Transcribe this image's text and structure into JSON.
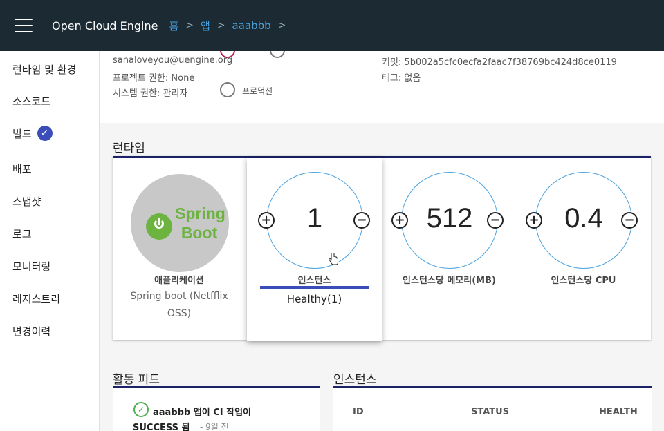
{
  "header": {
    "app_title": "Open Cloud Engine",
    "breadcrumb": [
      "홈",
      "앱",
      "aaabbb"
    ],
    "separator": ">"
  },
  "sidebar": {
    "items": [
      {
        "label": "런타임 및 환경"
      },
      {
        "label": "소스코드"
      },
      {
        "label": "빌드",
        "checked": true
      },
      {
        "label": "배포"
      },
      {
        "label": "스냅샷"
      },
      {
        "label": "로그"
      },
      {
        "label": "모니터링"
      },
      {
        "label": "레지스트리"
      },
      {
        "label": "변경이력"
      }
    ]
  },
  "info": {
    "email": "sanaloveyou@uengine.org",
    "project_permission": "프로젝트 권한: None",
    "system_permission": "시스템 권한: 관리자",
    "radio_production_label": "프로덕션",
    "commit": "커밋: 5b002a5cfc0ecfa2faac7f38769bc424d8ce0119",
    "tags": "태그: 없음"
  },
  "runtime": {
    "title": "런타임",
    "application": {
      "label": "애플리케이션",
      "logo_text_1": "Spring",
      "logo_text_2": "Boot",
      "sub_1": "Spring boot (Netfflix",
      "sub_2": "OSS)"
    },
    "instances": {
      "value": "1",
      "label": "인스턴스",
      "status": "Healthy(1)"
    },
    "memory": {
      "value": "512",
      "label": "인스턴스당 메모리(MB)"
    },
    "cpu": {
      "value": "0.4",
      "label": "인스턴스당 CPU"
    },
    "plus": "+",
    "minus": "−"
  },
  "activity": {
    "title": "활동 피드",
    "entry_line1": "aaabbb 앱이 CI 작업이",
    "entry_line2": "SUCCESS 됨",
    "entry_time": "- 9일 전"
  },
  "instances_table": {
    "title": "인스턴스",
    "columns": [
      "ID",
      "STATUS",
      "HEALTH"
    ]
  },
  "colors": {
    "topbar": "#1b2a33",
    "link": "#4aa3df",
    "accent": "#1b2266",
    "check": "#3b4db8",
    "spring_green": "#6cb33f"
  }
}
